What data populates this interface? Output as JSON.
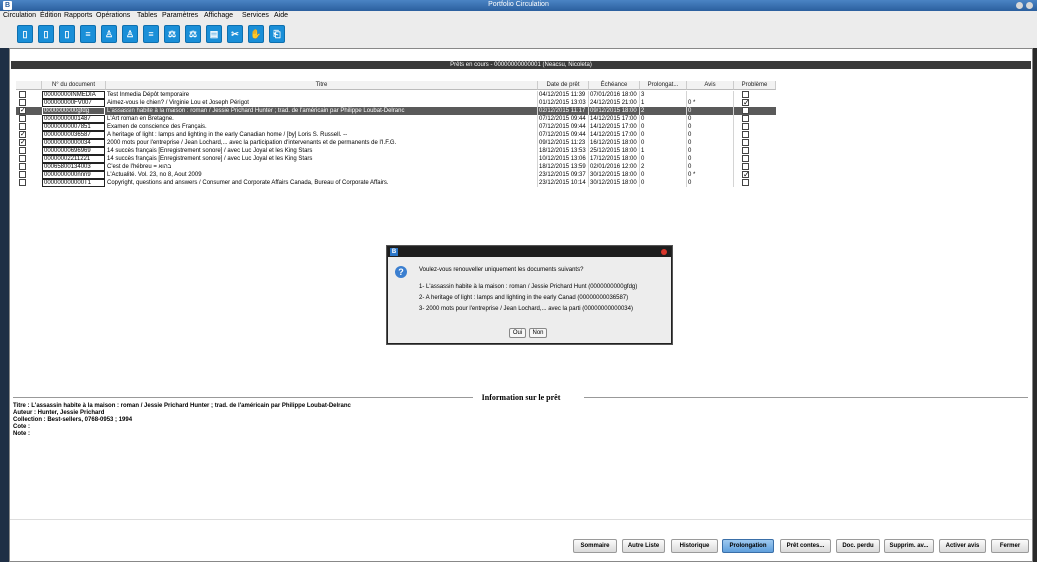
{
  "window": {
    "title": "Portfolio Circulation"
  },
  "menu": [
    "Circulation",
    "Édition",
    "Rapports",
    "Opérations",
    "Tables",
    "Paramètres",
    "Affichage",
    "Services",
    "Aide"
  ],
  "toolbar": {
    "accent": "#1a8fd8",
    "icons": [
      "doc-icon",
      "doc-icon",
      "doc-icon",
      "list-icon",
      "person-icon",
      "person-icon",
      "list-icon",
      "tool-icon",
      "tool-icon",
      "doc-icon",
      "scissors-icon",
      "hand-icon",
      "return-icon"
    ]
  },
  "loans": {
    "header": "Prêts en cours - 00000000000001 (Neacsu, Nicoleta)",
    "columns": [
      "N° du document",
      "Titre",
      "Date de prêt",
      "Échéance",
      "Prolongat...",
      "Avis",
      "Problème"
    ],
    "rows": [
      {
        "checked": false,
        "doc": "00000000INMEDIA",
        "title": "Test Inmedia Dépôt temporaire",
        "loan_date": "04/12/2015 11:39",
        "due": "07/01/2016 18:00",
        "renewals": "3",
        "notice": "",
        "problem": false,
        "selected": false
      },
      {
        "checked": false,
        "doc": "000000000FV007",
        "title": "Aimez-vous le chien? / Virginie Lou et Joseph Périgot",
        "loan_date": "01/12/2015 13:03",
        "due": "24/12/2015 21:00",
        "renewals": "1",
        "notice": "0 *",
        "problem": true,
        "selected": false
      },
      {
        "checked": true,
        "doc": "0000000000gfdg",
        "title": "L'assassin habite à la maison : roman / Jessie Prichard Hunter ; trad. de l'américain par Philippe Loubat-Delranc",
        "loan_date": "02/12/2015 11:17",
        "due": "09/12/2015 18:00",
        "renewals": "2",
        "notice": "0",
        "problem": false,
        "selected": true
      },
      {
        "checked": false,
        "doc": "00000000001487",
        "title": "L'Art roman en Bretagne.",
        "loan_date": "07/12/2015 09:44",
        "due": "14/12/2015 17:00",
        "renewals": "0",
        "notice": "0",
        "problem": false,
        "selected": false
      },
      {
        "checked": false,
        "doc": "00000000007851",
        "title": "Examen de conscience des Français.",
        "loan_date": "07/12/2015 09:44",
        "due": "14/12/2015 17:00",
        "renewals": "0",
        "notice": "0",
        "problem": false,
        "selected": false
      },
      {
        "checked": true,
        "doc": "00000000036587",
        "title": "A heritage of light : lamps and lighting in the early Canadian home / [by] Loris S. Russell. --",
        "loan_date": "07/12/2015 09:44",
        "due": "14/12/2015 17:00",
        "renewals": "0",
        "notice": "0",
        "problem": false,
        "selected": false
      },
      {
        "checked": true,
        "doc": "00000000000034",
        "title": "2000 mots pour l'entreprise / Jean Lochard,... avec la participation d'intervenants et de permanents de l'I.F.G.",
        "loan_date": "09/12/2015 11:23",
        "due": "16/12/2015 18:00",
        "renewals": "0",
        "notice": "0",
        "problem": false,
        "selected": false
      },
      {
        "checked": false,
        "doc": "00000000696969",
        "title": "14 succès français [Enregistrement sonore] / avec Luc Joyal et les King Stars",
        "loan_date": "18/12/2015 13:53",
        "due": "25/12/2015 18:00",
        "renewals": "1",
        "notice": "0",
        "problem": false,
        "selected": false
      },
      {
        "checked": false,
        "doc": "00000002211221",
        "title": "14 succès français [Enregistrement sonore] / avec Luc Joyal et les King Stars",
        "loan_date": "10/12/2015 13:06",
        "due": "17/12/2015 18:00",
        "renewals": "0",
        "notice": "0",
        "problem": false,
        "selected": false
      },
      {
        "checked": false,
        "doc": "00065800134003",
        "title": "C'est de l'hébreu = בהוא",
        "loan_date": "18/12/2015 13:59",
        "due": "02/01/2016 12:00",
        "renewals": "2",
        "notice": "0",
        "problem": false,
        "selected": false
      },
      {
        "checked": false,
        "doc": "0000000000nnn9",
        "title": "L'Actualité. Vol. 23, no 8, Aout 2009",
        "loan_date": "23/12/2015 09:37",
        "due": "30/12/2015 18:00",
        "renewals": "0",
        "notice": "0 *",
        "problem": true,
        "selected": false
      },
      {
        "checked": false,
        "doc": "000000000000T1",
        "title": "Copyright, questions and answers / Consumer and Corporate Affairs Canada, Bureau of Corporate Affairs.",
        "loan_date": "23/12/2015 10:14",
        "due": "30/12/2015 18:00",
        "renewals": "0",
        "notice": "0",
        "problem": false,
        "selected": false
      }
    ]
  },
  "dialog": {
    "question": "Voulez-vous renouveller uniquement les documents suivants?",
    "items": [
      "1- L'assassin habite à la maison : roman / Jessie Prichard Hunt (0000000000gfdg)",
      "2- A heritage of light : lamps and lighting in the early Canad (00000000036587)",
      "3- 2000 mots pour l'entreprise / Jean Lochard,... avec la parti (00000000000034)"
    ],
    "yes": "Oui",
    "no": "Non"
  },
  "info": {
    "title": "Information sur le prêt",
    "lines": [
      "Titre : L'assassin habite à la maison : roman / Jessie Prichard Hunter ; trad. de l'américain par Philippe Loubat-Delranc",
      "Auteur : Hunter, Jessie Prichard",
      "Collection : Best-sellers, 0768-0953 ; 1994",
      "Cote :",
      "Note :"
    ]
  },
  "actions": [
    "Sommaire",
    "Autre Liste",
    "Historique",
    "Prolongation",
    "Prêt contes...",
    "Doc. perdu",
    "Supprim. av...",
    "Activer avis",
    "Fermer"
  ],
  "active_action": "Prolongation"
}
